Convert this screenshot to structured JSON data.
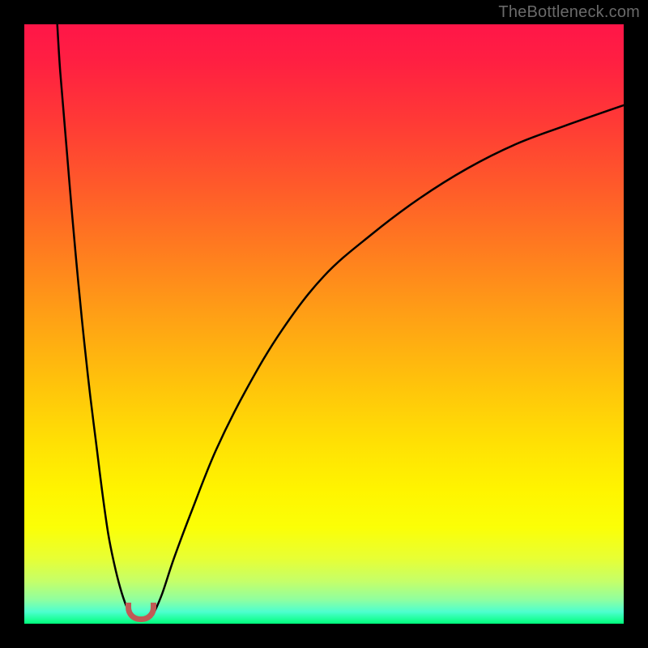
{
  "watermark": "TheBottleneck.com",
  "chart_data": {
    "type": "line",
    "title": "",
    "xlabel": "",
    "ylabel": "",
    "xlim": [
      0,
      100
    ],
    "ylim": [
      0,
      100
    ],
    "grid": false,
    "legend": false,
    "series": [
      {
        "name": "left-branch",
        "x": [
          5.5,
          6,
          7,
          8,
          9,
          10,
          11,
          12,
          13,
          14,
          15,
          16,
          17,
          17.8
        ],
        "y": [
          100,
          92,
          80,
          68,
          57,
          47,
          38,
          30,
          22,
          15,
          10,
          6,
          3,
          1.5
        ]
      },
      {
        "name": "right-branch",
        "x": [
          21.5,
          23,
          25,
          28,
          32,
          37,
          43,
          50,
          58,
          66,
          74,
          82,
          90,
          100
        ],
        "y": [
          1.5,
          5,
          11,
          19,
          29,
          39,
          49,
          58,
          65,
          71,
          76,
          80,
          83,
          86.5
        ]
      }
    ],
    "annotations": [
      {
        "name": "optimal-marker",
        "shape": "u",
        "x": 19.5,
        "y": 1.2,
        "color": "#c05a56"
      }
    ],
    "background_gradient": {
      "top": "#ff1648",
      "bottom": "#00ff7b"
    }
  }
}
